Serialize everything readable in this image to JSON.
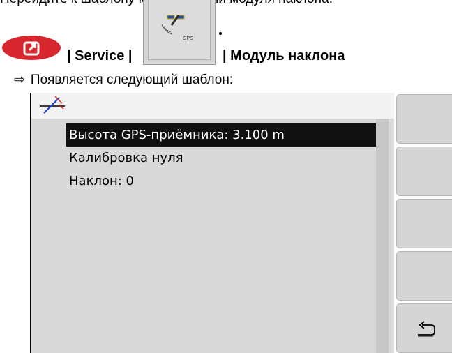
{
  "instruction_text": "Перейдите к шаблону конфигурации модуля наклона.",
  "breadcrumb": {
    "separator_1": "| Service |",
    "separator_2": "| Модуль наклона",
    "gps_button_label": "GPS"
  },
  "result_line": {
    "arrow": "⇨",
    "text": "Появляется следующий шаблон:"
  },
  "screen": {
    "menu_items": [
      {
        "label": "Высота GPS-приёмника: 3.100 m",
        "selected": true
      },
      {
        "label": "Калибровка нуля",
        "selected": false
      },
      {
        "label": "Наклон: 0",
        "selected": false
      }
    ],
    "softkeys": [
      "",
      "",
      "",
      "",
      "back-icon"
    ]
  },
  "colors": {
    "home_red": "#d8262e",
    "screen_bg": "#d9d9d9",
    "selection_bg": "#111111"
  }
}
